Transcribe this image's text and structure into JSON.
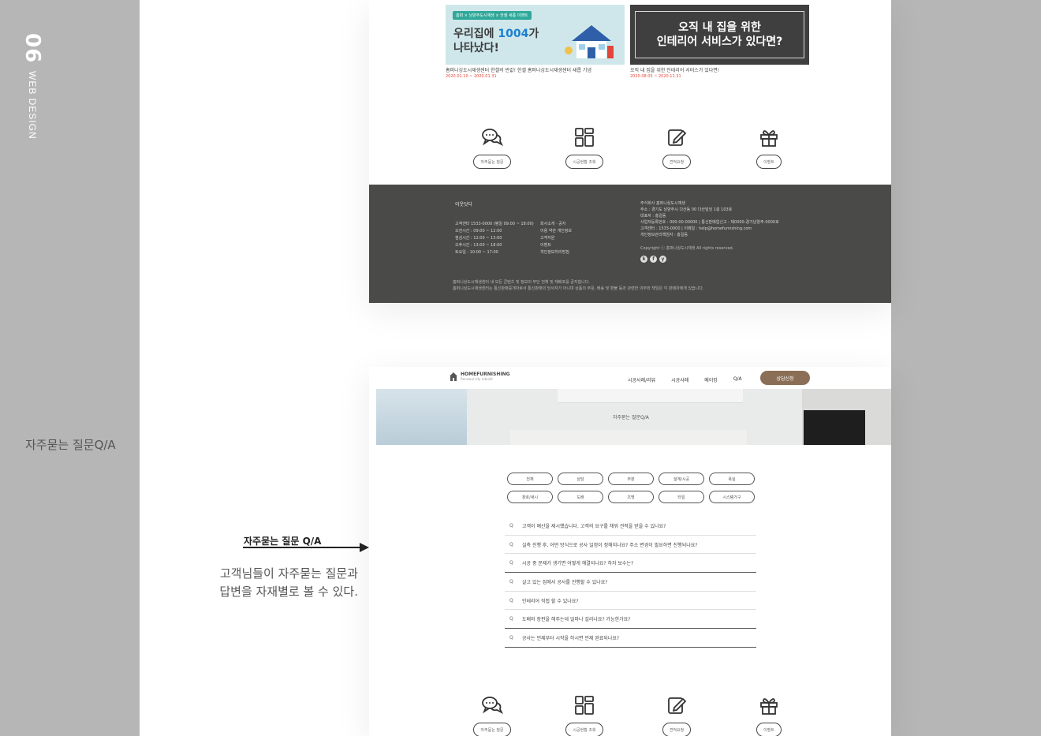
{
  "side": {
    "number": "06",
    "label": "WEB DESIGN",
    "caption": "자주묻는 질문Q/A"
  },
  "events": [
    {
      "tag": "홈퍼 × 남양주도시재생 × 한셀 새롭 이벤트",
      "title_line1": "우리집에 ",
      "title_highlight": "1004",
      "title_line1_end": "가",
      "title_line2": "나타났다!",
      "caption": "홈퍼니싱도시재생센터 한셀의 반값! 한셀 홈퍼니싱도시재생센터 새롭 기념",
      "date": "2020.01.10 ~ 2020.01.31"
    },
    {
      "title_line1": "오직 내 집을 위한",
      "title_line2": "인테리어 서비스가 있다면?",
      "caption": "오직 내 집을 위한 인테리어 서비스가 있다면!",
      "date": "2020.08.05 ~ 2020.12.31"
    }
  ],
  "quick_menu": [
    {
      "icon": "chat-bubbles-icon",
      "label": "자주묻는 질문"
    },
    {
      "icon": "grid-blocks-icon",
      "label": "시공현황 조회"
    },
    {
      "icon": "edit-note-icon",
      "label": "견적요청"
    },
    {
      "icon": "gift-icon",
      "label": "이벤트"
    }
  ],
  "footer": {
    "brand": "이웃닷다",
    "hours": [
      "고객센터 1533-0000 (평일 09:00 ~ 18:00)",
      "오전시간 : 09:00 ~ 12:00",
      "점심시간 : 12:00 ~ 13:00",
      "오후시간 : 13:00 ~ 18:00",
      "토요일 : 10:00 ~ 17:00"
    ],
    "links": [
      "회사소개 · 공지",
      "이용 약관 개인정보",
      "고객지원",
      "이벤트",
      "개인정보처리방침"
    ],
    "company": [
      "주식회사 홈퍼니싱도시재생",
      "주소 : 경기도 남양주시 다산동 00 다산빌딩 1층 103호",
      "대표자 : 홍길동",
      "사업자등록번호 : 000-00-00000 | 통신판매업신고 : 제0000-경기남양주-0000호",
      "고객센터 : 1533-0000 | 이메일 : help@homefurnishing.com",
      "개인정보관리책임자 : 홍길동"
    ],
    "copyright": "Copyright ⓒ 홈퍼니싱도시재생 All rights reserved.",
    "sns": [
      "k",
      "f",
      "y"
    ],
    "notice": [
      "홈퍼니싱도시재생센터 내 모든 콘텐츠 및 정보의 무단 전재 및 재배포를 금지합니다.",
      "홈퍼니싱도시재생센터는 통신판매중개자로서 통신판매의 당사자가 아니며 상품의 주문, 배송 및 환불 등과 관련한 의무와 책임은 각 판매자에게 있습니다."
    ]
  },
  "nav": {
    "logo": "HOMEFURNISHING",
    "logo_sub": "Renewal city rebuild",
    "menu": [
      "시공사례/리뷰",
      "시공사례",
      "메이킹",
      "Q/A"
    ],
    "cta": "상담신청"
  },
  "hero": {
    "title": "자주묻는 질문Q/A"
  },
  "categories": [
    [
      "전체",
      "상담",
      "부분",
      "설계/시공",
      "욕실"
    ],
    [
      "창호/새시",
      "도배",
      "조명",
      "타일",
      "시스템가구"
    ]
  ],
  "faq": [
    "고객이 예산을 제시했습니다. 고객의 요구를 채워 견적을 받을 수 있나요?",
    "실측 진행 후, 어떤 방식으로 공사 일정이 정해지나요? 주소 변경이 필요하면 진행되나요?",
    "시공 중 문제가 생기면 어떻게 해결되나요? 하자 보수는?",
    "살고 있는 집에서 공사를 진행할 수 있나요?",
    "인테리어 직접 할 수 있나요?",
    "도배와 장판을 해주는데 얼마나 걸리나요? 가능한가요?",
    "공사는 언제부터 시작을 하시면 언제 완료되나요?"
  ],
  "annotation": {
    "title": "자주묻는 질문 Q/A",
    "desc_line1": "고객님들이 자주묻는 질문과",
    "desc_line2": "답변을 자재별로 볼 수 있다."
  },
  "colors": {
    "side_panel": "#b5b6b5",
    "footer_bg": "#4a4a49",
    "cta": "#8b6e56",
    "event_date": "#e0453a",
    "highlight": "#1a7fd1"
  }
}
